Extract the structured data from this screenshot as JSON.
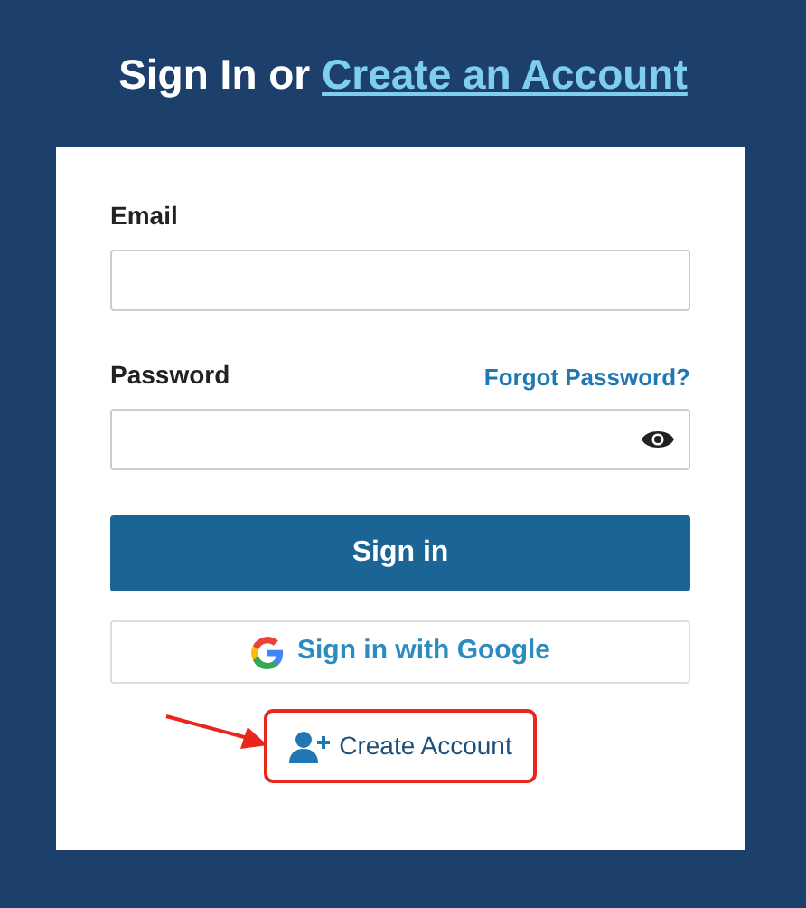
{
  "heading": {
    "text": "Sign In or ",
    "link": "Create an Account"
  },
  "fields": [
    {
      "label": "Email",
      "kind": "text"
    },
    {
      "label": "Password",
      "kind": "password",
      "link": "Forgot Password?"
    }
  ],
  "sign_in_button": "Sign in",
  "google_button": "Sign in with Google",
  "create_account": {
    "text": "Create Account",
    "highlighted": true
  }
}
